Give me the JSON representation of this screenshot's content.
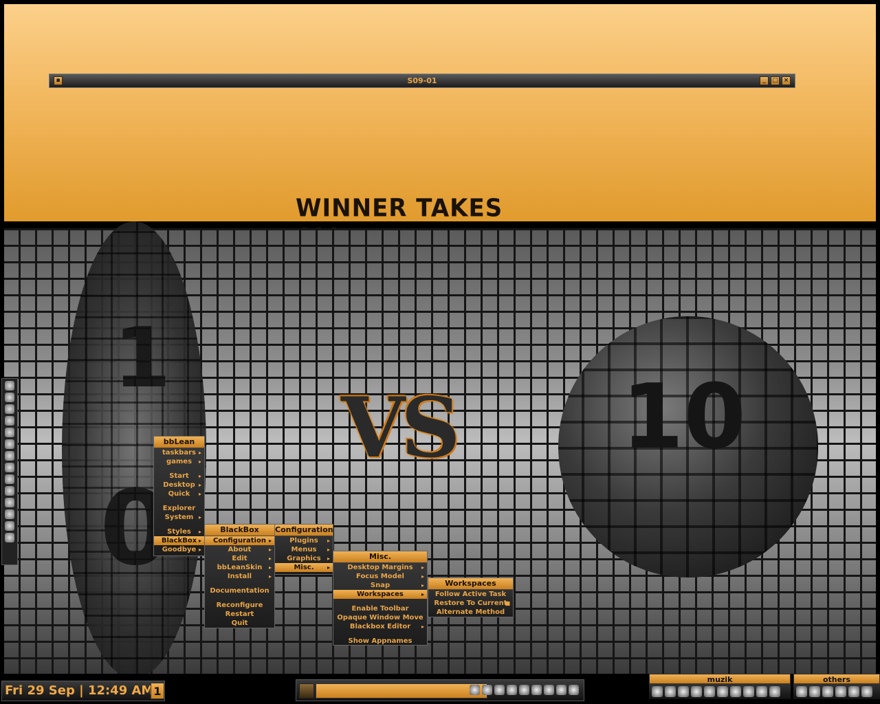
{
  "window": {
    "title": "S09-01",
    "buttons": [
      "minimize-button",
      "maximize-button",
      "close-button"
    ]
  },
  "wallpaper": {
    "slogan": "WINNER TAKES ALL",
    "left_label_top": "1",
    "left_label_bottom": "0",
    "center_label": "VS",
    "right_label": "10"
  },
  "dock": {
    "icons": [
      "app-icon-1",
      "search-icon",
      "globe-icon",
      "film-icon",
      "music-icon",
      "chat-icon",
      "document-icon",
      "archive-icon",
      "refresh-icon",
      "users-icon",
      "headphones-icon",
      "disc-icon",
      "star-icon",
      "smiley-icon"
    ]
  },
  "menus": {
    "bblean": {
      "title": "bbLean",
      "items": [
        {
          "label": "taskbars",
          "arrow": "▸"
        },
        {
          "label": "games",
          "arrow": "▸"
        },
        {
          "label": "Start",
          "arrow": "▸",
          "gap": true
        },
        {
          "label": "Desktop",
          "arrow": "▸"
        },
        {
          "label": "Quick",
          "arrow": "▸"
        },
        {
          "label": "Explorer",
          "arrow": "",
          "gap": true
        },
        {
          "label": "System",
          "arrow": "▸"
        },
        {
          "label": "Styles",
          "arrow": "▸",
          "gap": true
        },
        {
          "label": "BlackBox",
          "arrow": "▸",
          "selected": true
        },
        {
          "label": "Goodbye",
          "arrow": "▸"
        }
      ]
    },
    "blackbox": {
      "title": "BlackBox",
      "items": [
        {
          "label": "Configuration",
          "arrow": "▸",
          "selected": true
        },
        {
          "label": "About",
          "arrow": "▸"
        },
        {
          "label": "Edit",
          "arrow": "▸"
        },
        {
          "label": "bbLeanSkin",
          "arrow": "▸"
        },
        {
          "label": "Install",
          "arrow": "▸"
        },
        {
          "label": "Documentation",
          "arrow": "",
          "gap": true
        },
        {
          "label": "Reconfigure",
          "arrow": "",
          "gap": true
        },
        {
          "label": "Restart",
          "arrow": ""
        },
        {
          "label": "Quit",
          "arrow": ""
        }
      ]
    },
    "configuration": {
      "title": "Configuration",
      "items": [
        {
          "label": "Plugins",
          "arrow": "▸"
        },
        {
          "label": "Menus",
          "arrow": "▸"
        },
        {
          "label": "Graphics",
          "arrow": "▸"
        },
        {
          "label": "Misc.",
          "arrow": "▸",
          "selected": true
        }
      ]
    },
    "misc": {
      "title": "Misc.",
      "items": [
        {
          "label": "Desktop Margins",
          "arrow": "▸"
        },
        {
          "label": "Focus Model",
          "arrow": "▸"
        },
        {
          "label": "Snap",
          "arrow": "▸"
        },
        {
          "label": "Workspaces",
          "arrow": "▸",
          "selected": true
        },
        {
          "label": "Enable Toolbar",
          "arrow": "",
          "gap": true
        },
        {
          "label": "Opaque Window Move",
          "arrow": ""
        },
        {
          "label": "Blackbox Editor",
          "arrow": "▸"
        },
        {
          "label": "Show Appnames",
          "arrow": "",
          "gap": true
        }
      ]
    },
    "workspaces": {
      "title": "Workspaces",
      "items": [
        {
          "label": "Follow Active Task",
          "arrow": ""
        },
        {
          "label": "Restore To Current",
          "arrow": "■"
        },
        {
          "label": "Alternate Method",
          "arrow": ""
        }
      ]
    }
  },
  "toolbar": {
    "clock": "Fri 29 Sep | 12:49 AM",
    "workspace_number": "1"
  },
  "slits": {
    "muzik": {
      "title": "muzik"
    },
    "others": {
      "title": "others"
    }
  },
  "colors": {
    "accent": "#e9a548",
    "accent_dark": "#c9801f",
    "menu_bg": "#222222"
  }
}
